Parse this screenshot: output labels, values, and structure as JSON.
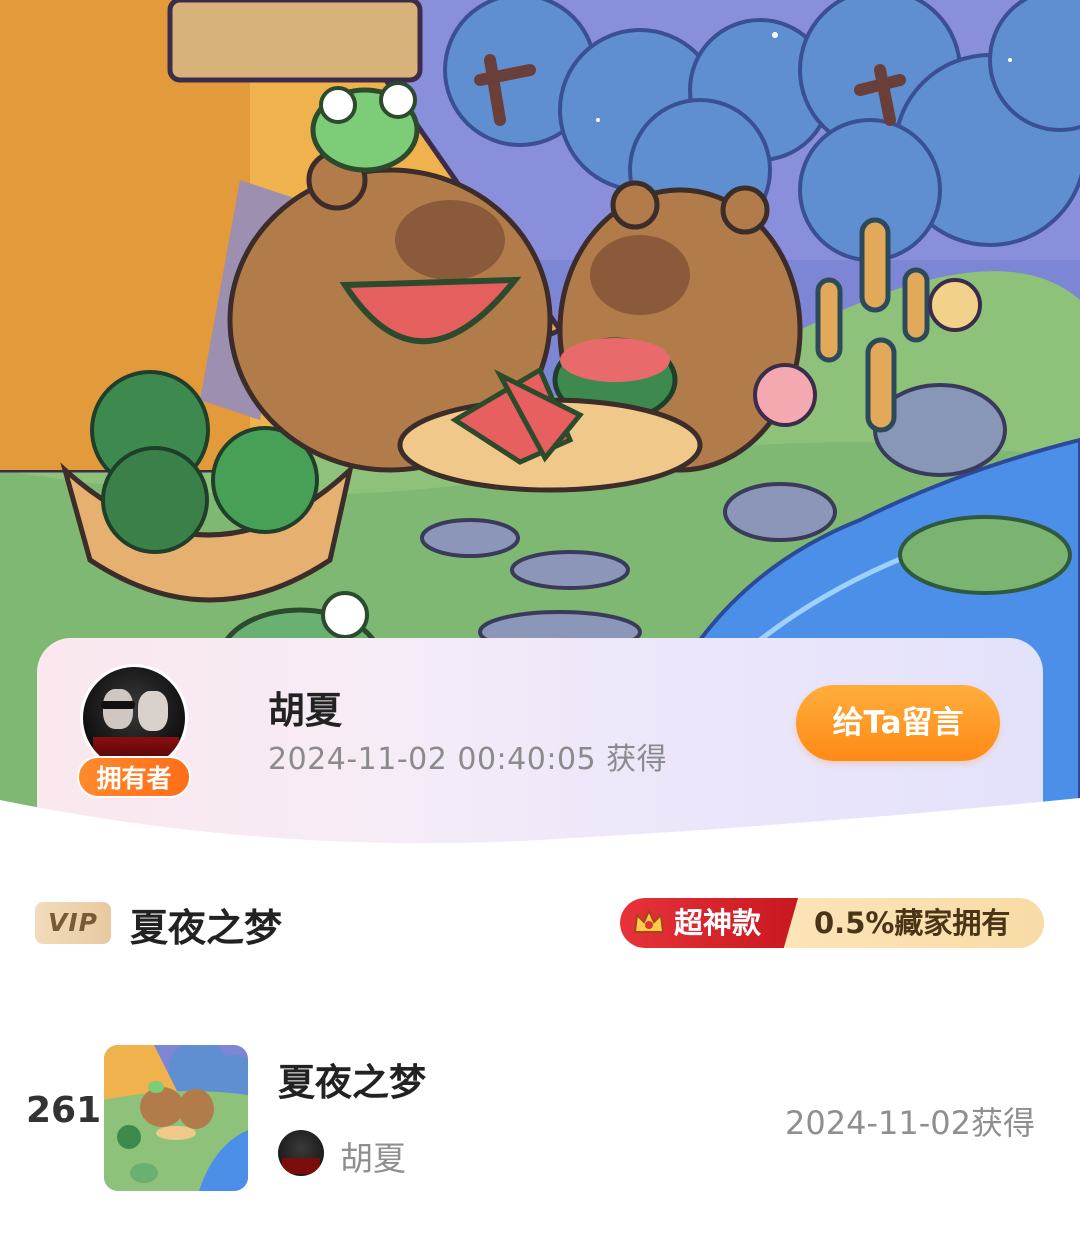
{
  "owner": {
    "name": "胡夏",
    "acquired_time": "2024-11-02 00:40:05 获得",
    "badge": "拥有者",
    "message_button": "给Ta留言"
  },
  "item": {
    "vip_label": "VIP",
    "title": "夏夜之梦",
    "rarity_label": "超神款",
    "rarity_share": "0.5%藏家拥有"
  },
  "list": [
    {
      "rank": "261",
      "title": "夏夜之梦",
      "owner": "胡夏",
      "date": "2024-11-02获得"
    }
  ],
  "colors": {
    "accent_orange": "#ff8a16",
    "rarity_red": "#d8242b",
    "rarity_gold": "#f8dca6",
    "vip_gold": "#e8c9a0"
  },
  "icons": [
    "crown-icon",
    "owner-avatar",
    "artwork-thumbnail"
  ]
}
